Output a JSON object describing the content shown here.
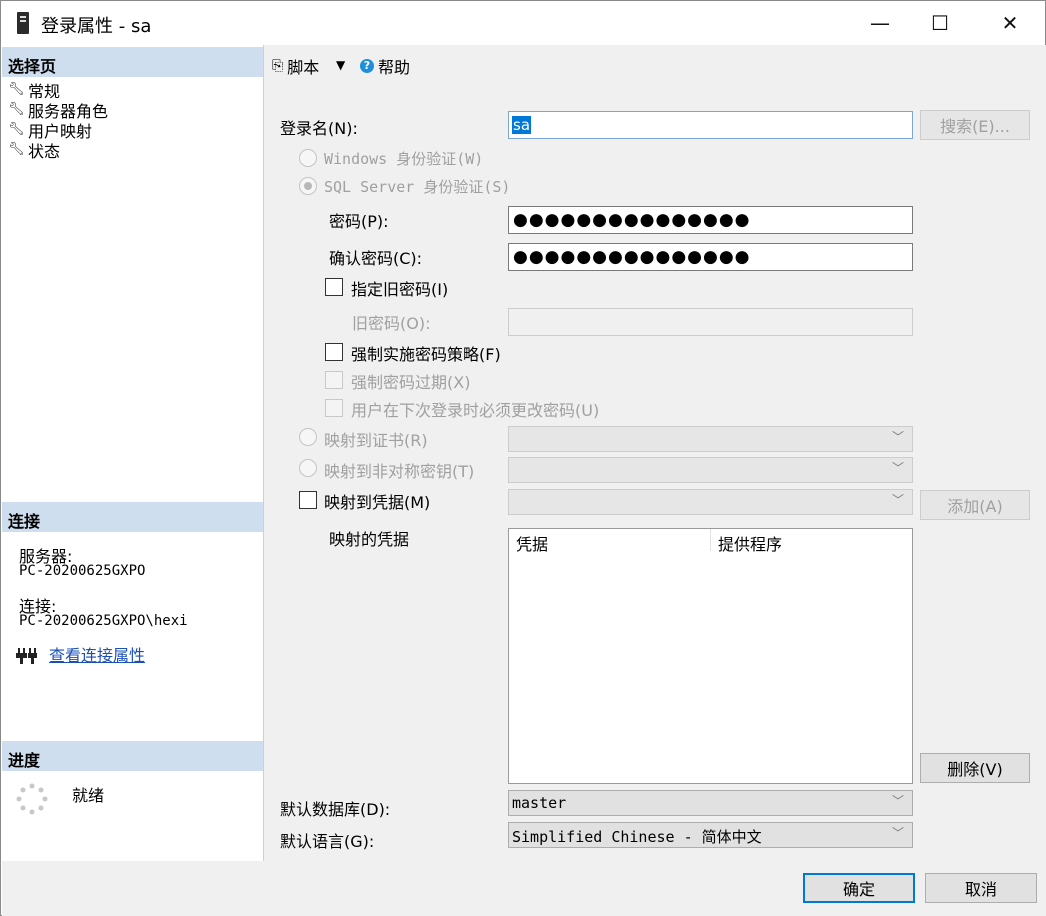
{
  "window": {
    "title": "登录属性 - sa",
    "minimize": "—",
    "maximize": "☐",
    "close": "✕"
  },
  "left": {
    "select_page_header": "选择页",
    "nav": [
      "常规",
      "服务器角色",
      "用户映射",
      "状态"
    ],
    "connection_header": "连接",
    "server_label": "服务器:",
    "server_value": "PC-20200625GXPO",
    "connection_label": "连接:",
    "connection_value": "PC-20200625GXPO\\hexi",
    "view_connection_link": "查看连接属性",
    "progress_header": "进度",
    "progress_status": "就绪"
  },
  "toolbar": {
    "script_label": "脚本",
    "help_label": "帮助"
  },
  "form": {
    "login_name_label": "登录名(N):",
    "login_name_value": "sa",
    "search_button": "搜索(E)...",
    "windows_auth": "Windows 身份验证(W)",
    "sql_auth": "SQL Server 身份验证(S)",
    "password_label": "密码(P):",
    "password_mask": "●●●●●●●●●●●●●●●",
    "confirm_label": "确认密码(C):",
    "confirm_mask": "●●●●●●●●●●●●●●●",
    "specify_old": "指定旧密码(I)",
    "old_password_label": "旧密码(O):",
    "enforce_policy": "强制实施密码策略(F)",
    "enforce_expiration": "强制密码过期(X)",
    "must_change": "用户在下次登录时必须更改密码(U)",
    "map_cert": "映射到证书(R)",
    "map_asym": "映射到非对称密钥(T)",
    "map_cred": "映射到凭据(M)",
    "add_button": "添加(A)",
    "mapped_creds_label": "映射的凭据",
    "grid_col1": "凭据",
    "grid_col2": "提供程序",
    "remove_button": "删除(V)",
    "default_db_label": "默认数据库(D):",
    "default_db_value": "master",
    "default_lang_label": "默认语言(G):",
    "default_lang_value": "Simplified Chinese - 简体中文"
  },
  "footer": {
    "ok": "确定",
    "cancel": "取消"
  },
  "colors": {
    "section_header": "#cfdeee",
    "accent": "#0078d7",
    "link": "#1a4fb8"
  }
}
